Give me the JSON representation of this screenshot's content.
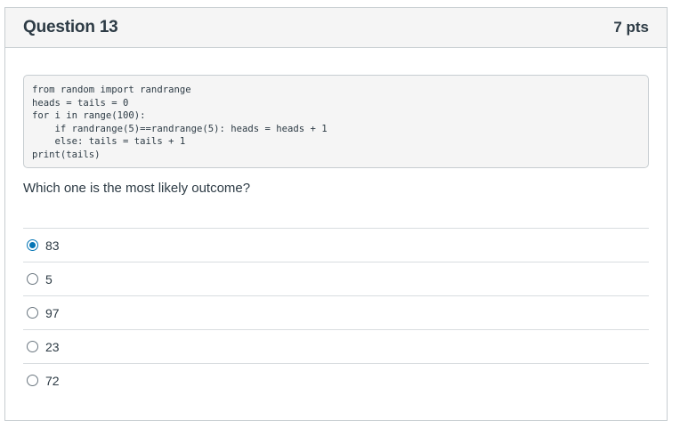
{
  "question": {
    "title": "Question 13",
    "points": "7 pts",
    "code": "from random import randrange\nheads = tails = 0\nfor i in range(100):\n    if randrange(5)==randrange(5): heads = heads + 1\n    else: tails = tails + 1\nprint(tails)",
    "prompt": "Which one is the most likely outcome?",
    "answers": [
      {
        "label": "83",
        "selected": true
      },
      {
        "label": "5",
        "selected": false
      },
      {
        "label": "97",
        "selected": false
      },
      {
        "label": "23",
        "selected": false
      },
      {
        "label": "72",
        "selected": false
      }
    ]
  },
  "colors": {
    "accent": "#0374b5",
    "border": "#c7cdd1",
    "header_bg": "#f5f5f5",
    "text": "#2d3b45"
  }
}
